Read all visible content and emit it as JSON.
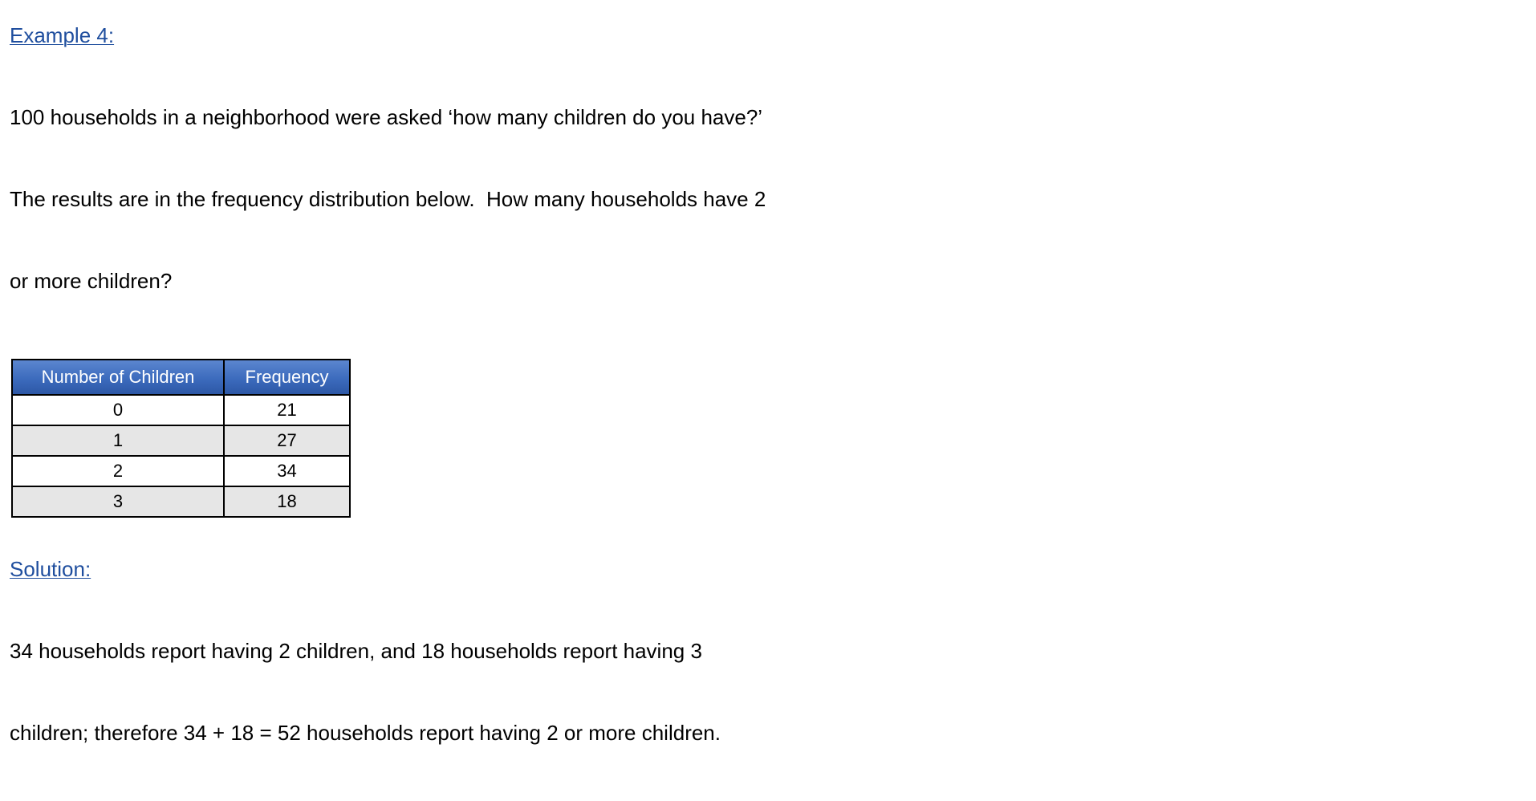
{
  "example": {
    "heading": "Example 4:",
    "question_lines": [
      "100 households in a neighborhood were asked ‘how many children do you have?’",
      "The results are in the frequency distribution below.  How many households have 2",
      "or more children?"
    ]
  },
  "table": {
    "headers": [
      "Number of Children",
      "Frequency"
    ],
    "rows": [
      [
        "0",
        "21"
      ],
      [
        "1",
        "27"
      ],
      [
        "2",
        "34"
      ],
      [
        "3",
        "18"
      ]
    ],
    "colors": {
      "header_bg": "#3c6bbd",
      "header_text": "#ffffff",
      "alt_row_bg": "#e6e6e6",
      "border": "#000000"
    }
  },
  "solution": {
    "heading": "Solution:",
    "lines": [
      "34 households report having 2 children, and 18 households report having 3",
      "children; therefore 34 + 18 = 52 households report having 2 or more children."
    ]
  },
  "colors": {
    "heading": "#1f4e9e",
    "text": "#000000"
  }
}
